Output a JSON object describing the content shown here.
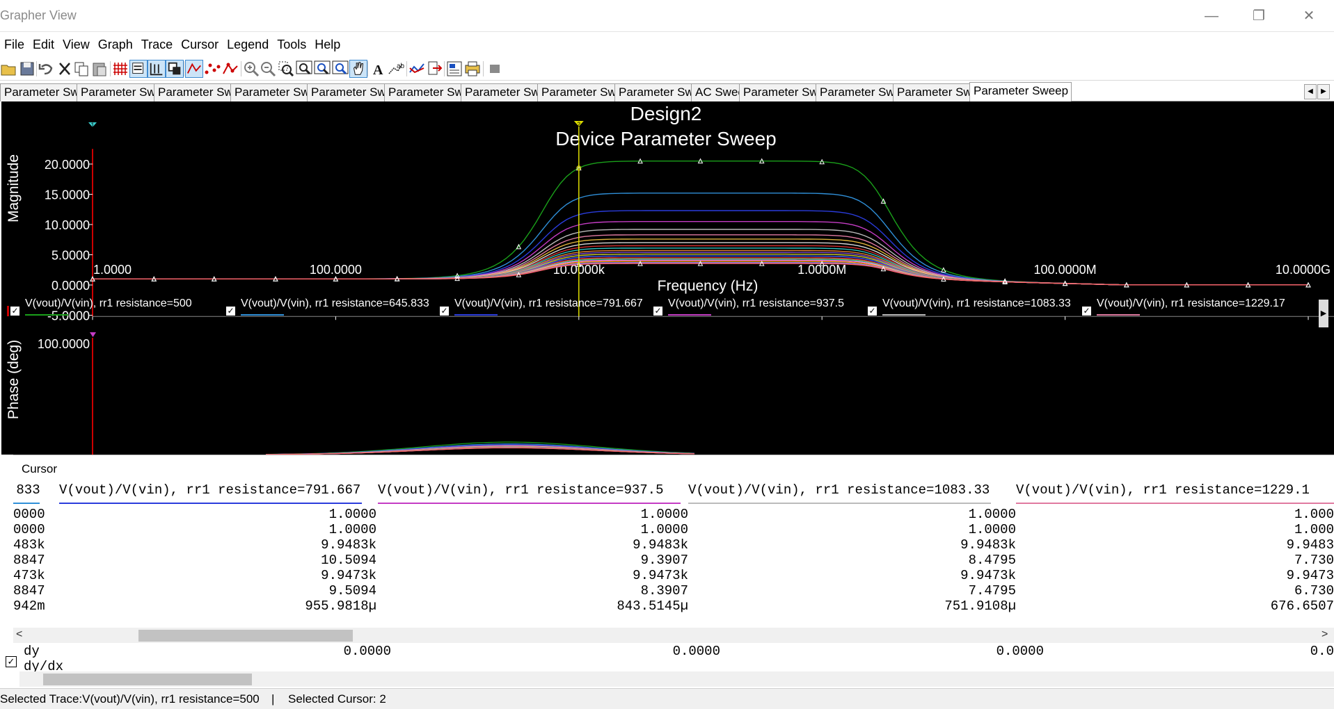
{
  "window": {
    "title": "Grapher View",
    "minimize_glyph": "—",
    "restore_glyph": "❐",
    "close_glyph": "✕"
  },
  "menu": [
    "File",
    "Edit",
    "View",
    "Graph",
    "Trace",
    "Cursor",
    "Legend",
    "Tools",
    "Help"
  ],
  "toolbar_icons": [
    "open-icon",
    "save-icon",
    "undo-icon",
    "cut-icon",
    "copy-icon",
    "paste-icon",
    "grid-icon",
    "legend-icon",
    "cursors-icon",
    "overlay-icon",
    "pointer-icon",
    "points-icon",
    "dots-icon",
    "zoom-in-icon",
    "zoom-out-icon",
    "zoom-area-icon",
    "zoom-full-icon",
    "zoom-x-icon",
    "zoom-y-icon",
    "pan-icon",
    "text-icon",
    "label-icon",
    "trace-icon",
    "export-icon",
    "properties-icon",
    "print-icon",
    "stop-icon"
  ],
  "tabs": [
    "Parameter Sweep",
    "Parameter Sweep",
    "Parameter Sweep",
    "Parameter Sweep",
    "Parameter Sweep",
    "Parameter Sweep",
    "Parameter Sweep",
    "Parameter Sweep",
    "Parameter Sweep",
    "AC Sweep",
    "Parameter Sweep",
    "Parameter Sweep",
    "Parameter Sweep",
    "Parameter Sweep"
  ],
  "graph": {
    "title": "Design2",
    "subtitle": "Device Parameter Sweep",
    "ylabel_top": "Magnitude",
    "xlabel": "Frequency (Hz)",
    "ylabel_bottom": "Phase (deg)",
    "yticks_top": [
      "20.0000",
      "15.0000",
      "10.0000",
      "5.0000",
      "0.0000",
      "-5.0000"
    ],
    "xticks": [
      "1.0000",
      "100.0000",
      "10.0000k",
      "1.0000M",
      "100.0000M",
      "10.0000G"
    ],
    "ytick_bottom": "100.0000",
    "cursor_marker_1": "1",
    "cursor_marker_2": "2",
    "background": "#000000",
    "legend_scroll_glyph": "▶"
  },
  "chart_data": {
    "type": "line",
    "title": "Design2",
    "subtitle": "Device Parameter Sweep",
    "xlabel": "Frequency (Hz)",
    "ylabel": "Magnitude",
    "xscale": "log",
    "xlim": [
      1,
      10000000000
    ],
    "ylim": [
      -5,
      22
    ],
    "grid": false,
    "x": [
      1,
      2,
      5,
      10,
      20,
      50,
      100,
      200,
      500,
      1000,
      2000,
      5000,
      10000,
      20000,
      50000,
      100000,
      200000,
      500000,
      1000000,
      2000000,
      5000000,
      10000000,
      20000000,
      100000000,
      1000000000,
      10000000000
    ],
    "series": [
      {
        "name": "V(vout)/V(vin), rr1 resistance=500",
        "color": "#1aa01a",
        "peak": 20.5
      },
      {
        "name": "V(vout)/V(vin), rr1 resistance=645.833",
        "color": "#2f8fd8",
        "peak": 15.2
      },
      {
        "name": "V(vout)/V(vin), rr1 resistance=791.667",
        "color": "#2a3cdc",
        "peak": 12.3
      },
      {
        "name": "V(vout)/V(vin), rr1 resistance=937.5",
        "color": "#c43cc4",
        "peak": 10.5
      },
      {
        "name": "V(vout)/V(vin), rr1 resistance=1083.33",
        "color": "#bbbbbb",
        "peak": 9.2
      },
      {
        "name": "V(vout)/V(vin), rr1 resistance=1229.17",
        "color": "#e07aa0",
        "peak": 8.3
      },
      {
        "color": "#e0b43c",
        "peak": 7.6
      },
      {
        "color": "#d8d8d8",
        "peak": 7.0
      },
      {
        "color": "#d03030",
        "peak": 6.5
      },
      {
        "color": "#30c0c0",
        "peak": 6.1
      },
      {
        "color": "#e08030",
        "peak": 5.7
      },
      {
        "color": "#8050d0",
        "peak": 5.4
      },
      {
        "color": "#d0d030",
        "peak": 5.1
      },
      {
        "color": "#4060ff",
        "peak": 4.8
      },
      {
        "color": "#ff4040",
        "peak": 4.5
      },
      {
        "color": "#40d080",
        "peak": 4.3
      },
      {
        "color": "#ff80ff",
        "peak": 4.1
      },
      {
        "color": "#ffa000",
        "peak": 3.9
      },
      {
        "color": "#8080ff",
        "peak": 3.7
      },
      {
        "color": "#ff6060",
        "peak": 3.55
      }
    ]
  },
  "legend": [
    {
      "label": "V(vout)/V(vin), rr1 resistance=500",
      "color": "#1aa01a",
      "checked": true
    },
    {
      "label": "V(vout)/V(vin), rr1 resistance=645.833",
      "color": "#2f8fd8",
      "checked": true
    },
    {
      "label": "V(vout)/V(vin), rr1 resistance=791.667",
      "color": "#2a3cdc",
      "checked": true
    },
    {
      "label": "V(vout)/V(vin), rr1 resistance=937.5",
      "color": "#c43cc4",
      "checked": true
    },
    {
      "label": "V(vout)/V(vin), rr1 resistance=1083.33",
      "color": "#bbbbbb",
      "checked": true
    },
    {
      "label": "V(vout)/V(vin), rr1 resistance=1229.17",
      "color": "#e07aa0",
      "checked": true
    }
  ],
  "cursor_panel": {
    "title": "Cursor",
    "columns": [
      {
        "header": ".833",
        "color": "#2f8fd8",
        "values": [
          "0000",
          "0000",
          "483k",
          "8847",
          "473k",
          "8847",
          "942m"
        ]
      },
      {
        "header": "V(vout)/V(vin), rr1 resistance=791.667",
        "color": "#2a3cdc",
        "values": [
          "1.0000",
          "1.0000",
          "9.9483k",
          "10.5094",
          "9.9473k",
          "9.5094",
          "955.9818µ"
        ]
      },
      {
        "header": "V(vout)/V(vin), rr1 resistance=937.5",
        "color": "#c43cc4",
        "values": [
          "1.0000",
          "1.0000",
          "9.9483k",
          "9.3907",
          "9.9473k",
          "8.3907",
          "843.5145µ"
        ]
      },
      {
        "header": "V(vout)/V(vin), rr1 resistance=1083.33",
        "color": "#bbbbbb",
        "values": [
          "1.0000",
          "1.0000",
          "9.9483k",
          "8.4795",
          "9.9473k",
          "7.4795",
          "751.9108µ"
        ]
      },
      {
        "header": "V(vout)/V(vin), rr1 resistance=1229.1",
        "color": "#e07aa0",
        "values": [
          "1.000",
          "1.000",
          "9.9483",
          "7.730",
          "9.9473",
          "6.730",
          "676.6507"
        ]
      }
    ],
    "scroll_left": "<",
    "scroll_right": ">"
  },
  "under_rows": {
    "labels": [
      "dy",
      "dy/dx"
    ],
    "dy_values": [
      "0.0000",
      "0.0000",
      "0.0000",
      "0.0"
    ]
  },
  "status": {
    "selected_trace": "Selected Trace:V(vout)/V(vin), rr1 resistance=500",
    "separator": "|",
    "selected_cursor": "Selected Cursor: 2"
  }
}
